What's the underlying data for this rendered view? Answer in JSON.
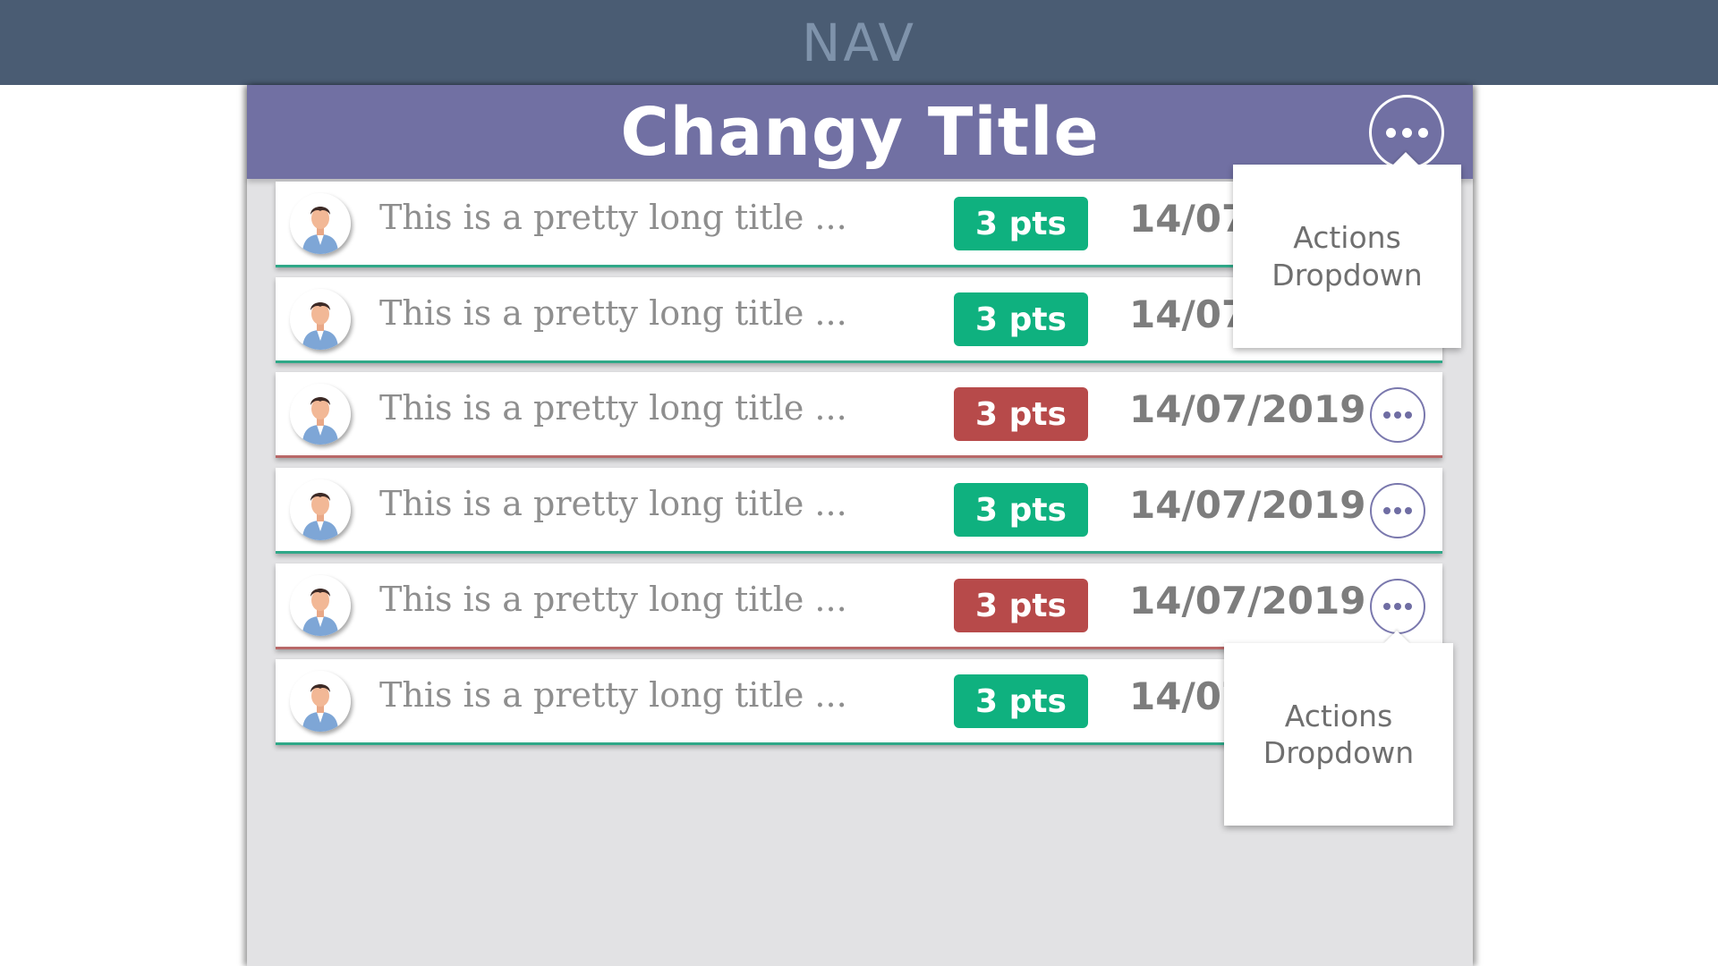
{
  "nav": {
    "label": "NAV"
  },
  "panel": {
    "title": "Changy Title",
    "header_actions_icon": "more-horizontal-icon"
  },
  "colors": {
    "nav": "#4a5c73",
    "header": "#7170a3",
    "panel_bg": "#e2e2e4",
    "pts_green": "#0fb17f",
    "pts_red": "#b74a4a"
  },
  "rows": [
    {
      "title": "This is a pretty long title ...",
      "points": "3 pts",
      "status": "green",
      "date": "14/07/2019",
      "avatar": "user-avatar-icon",
      "actions_icon": "more-horizontal-icon"
    },
    {
      "title": "This is a pretty long title ...",
      "points": "3 pts",
      "status": "green",
      "date": "14/07/2019",
      "avatar": "user-avatar-icon",
      "actions_icon": "more-horizontal-icon"
    },
    {
      "title": "This is a pretty long title ...",
      "points": "3 pts",
      "status": "red",
      "date": "14/07/2019",
      "avatar": "user-avatar-icon",
      "actions_icon": "more-horizontal-icon"
    },
    {
      "title": "This is a pretty long title ...",
      "points": "3 pts",
      "status": "green",
      "date": "14/07/2019",
      "avatar": "user-avatar-icon",
      "actions_icon": "more-horizontal-icon"
    },
    {
      "title": "This is a pretty long title ...",
      "points": "3 pts",
      "status": "red",
      "date": "14/07/2019",
      "avatar": "user-avatar-icon",
      "actions_icon": "more-horizontal-icon"
    },
    {
      "title": "This is a pretty long title ...",
      "points": "3 pts",
      "status": "green",
      "date": "14/07/2019",
      "avatar": "user-avatar-icon",
      "actions_icon": "more-horizontal-icon"
    }
  ],
  "dropdowns": [
    {
      "label": "Actions\nDropdown"
    },
    {
      "label": "Actions\nDropdown"
    }
  ]
}
